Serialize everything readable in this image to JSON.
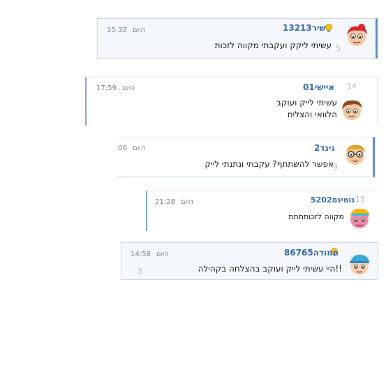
{
  "comments": [
    {
      "username": "שיר13213",
      "day": "היום",
      "time": "15:32",
      "lines": [
        "עשיתי ליקק ועקבתי מקווה לזכות"
      ],
      "number": "5",
      "badge_icon": "lightbulb-icon",
      "avatar_icon": "red-hair-girl-avatar-icon"
    },
    {
      "username": "איישי01",
      "day": "היום",
      "time": "17:59",
      "lines": [
        "עשיתי לייק ועוקב",
        "הלוואי והצליח"
      ],
      "number": "14",
      "avatar_icon": "brown-hair-kid-avatar-icon"
    },
    {
      "username": "גינד2",
      "day": "היום",
      "time": "06:",
      "lines": [
        "אפשר להשתתף? עקבתי ונתנתי לייק"
      ],
      "number": "9",
      "avatar_icon": "glasses-kid-avatar-icon"
    },
    {
      "username": "גומיגם5202",
      "day": "היום",
      "time": "21:28",
      "lines": [
        "מקווה לזכותתתת"
      ],
      "number": "15",
      "avatar_icon": "pink-face-cap-avatar-icon"
    },
    {
      "username": "חמודה86765",
      "day": "היום",
      "time": "14:58",
      "lines": [
        "היי עשיתי לייק ועוקב בהצלחה בקהילה!!"
      ],
      "number": "3",
      "badge_icon": "lightbulb-icon",
      "avatar_icon": "blue-cap-kid-avatar-icon"
    }
  ]
}
